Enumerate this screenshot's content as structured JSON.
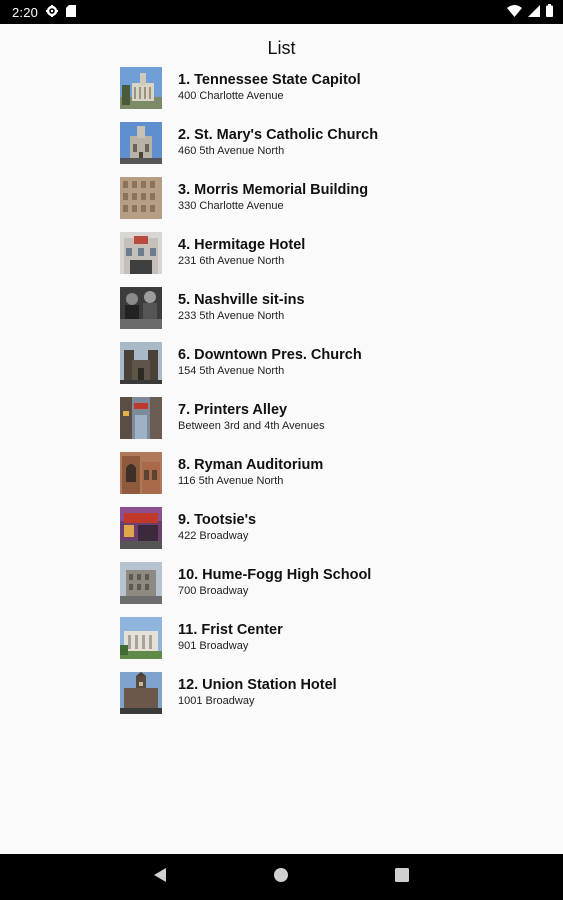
{
  "status_bar": {
    "time": "2:20",
    "icons": [
      "gear-icon",
      "sd-card-icon",
      "wifi-icon",
      "signal-icon",
      "battery-icon"
    ]
  },
  "page": {
    "title": "List"
  },
  "places": [
    {
      "name": "1. Tennessee State Capitol",
      "address": "400 Charlotte Avenue"
    },
    {
      "name": "2. St. Mary's Catholic Church",
      "address": "460 5th Avenue North"
    },
    {
      "name": "3. Morris Memorial Building",
      "address": "330 Charlotte Avenue"
    },
    {
      "name": "4. Hermitage Hotel",
      "address": "231 6th Avenue North"
    },
    {
      "name": "5. Nashville sit-ins",
      "address": "233 5th Avenue North"
    },
    {
      "name": "6. Downtown Pres. Church",
      "address": "154 5th Avenue North"
    },
    {
      "name": "7. Printers Alley",
      "address": "Between 3rd and 4th Avenues"
    },
    {
      "name": "8. Ryman Auditorium",
      "address": "116 5th Avenue North"
    },
    {
      "name": "9. Tootsie's",
      "address": "422 Broadway"
    },
    {
      "name": "10. Hume-Fogg High School",
      "address": "700 Broadway"
    },
    {
      "name": "11. Frist Center",
      "address": "901 Broadway"
    },
    {
      "name": "12. Union Station Hotel",
      "address": "1001 Broadway"
    }
  ],
  "nav_bar": {
    "buttons": [
      "back-icon",
      "home-icon",
      "recents-icon"
    ]
  }
}
